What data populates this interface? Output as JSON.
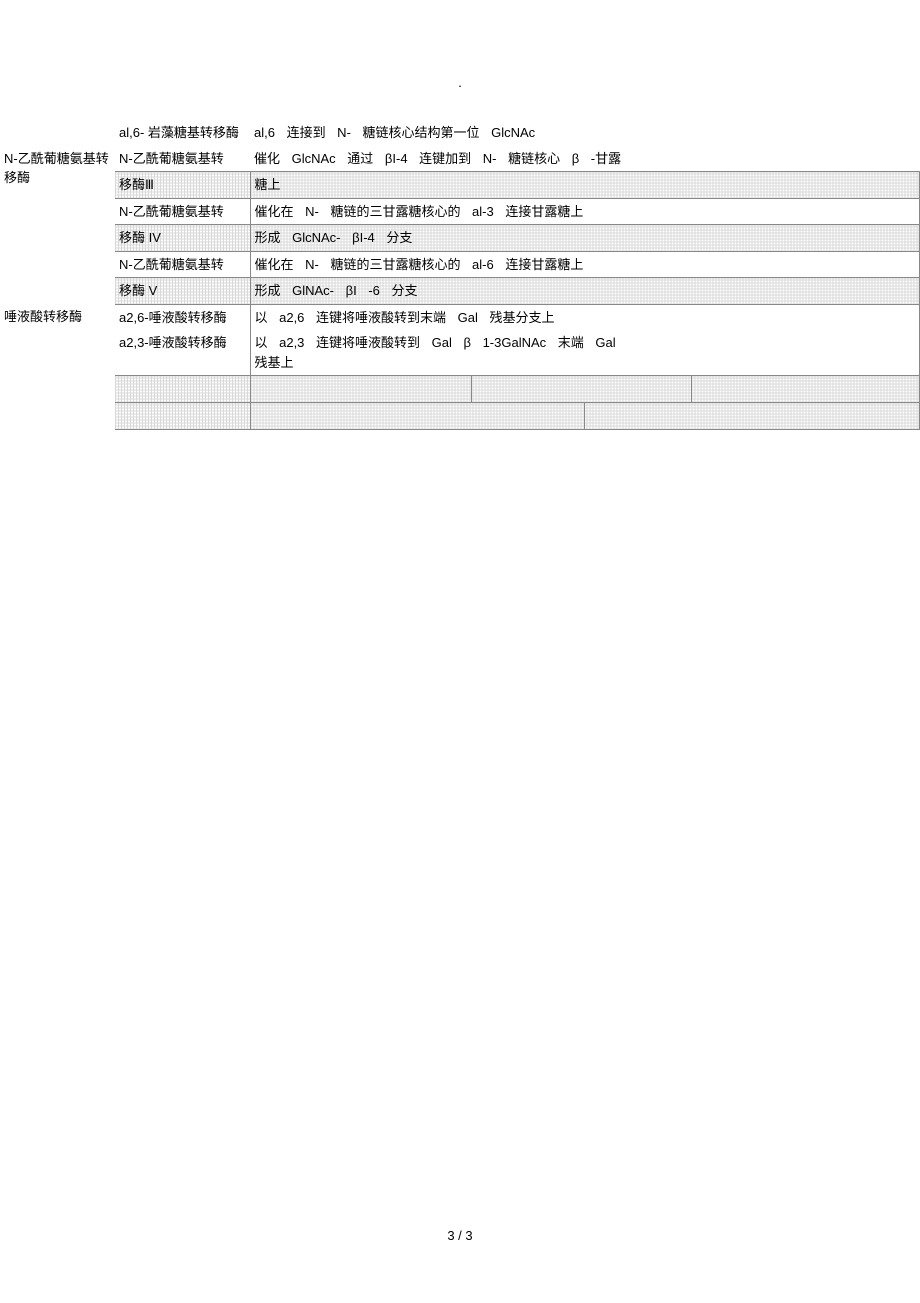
{
  "header": {
    "dot": "."
  },
  "rows": [
    {
      "category": "",
      "enzyme": "al,6- 岩藻糖基转移酶",
      "description": "al,6 连接到 N- 糖链核心结构第一位    GlcNAc"
    },
    {
      "category": "N-乙酰葡糖氨基转移酶",
      "enzyme": "N-乙酰葡糖氨基转移酶Ⅲ",
      "description": "催化 GlcNAc  通过 βI-4 连键加到  N- 糖链核心   β -甘露糖上"
    },
    {
      "category": "",
      "enzyme": "N-乙酰葡糖氨基转移酶 IV",
      "description": "催化在  N- 糖链的三甘露糖核心的     al-3 连接甘露糖上形成 GlcNAc- βI-4 分支"
    },
    {
      "category": "",
      "enzyme": "N-乙酰葡糖氨基转移酶 V",
      "description": "催化在  N- 糖链的三甘露糖核心的     al-6 连接甘露糖上形成 GlNAc- βI -6 分支"
    },
    {
      "category": "唾液酸转移酶",
      "enzyme": "a2,6-唾液酸转移酶",
      "description": "以 a2,6 连键将唾液酸转到末端     Gal 残基分支上"
    },
    {
      "category": "",
      "enzyme": "a2,3-唾液酸转移酶",
      "description": "以 a2,3 连键将唾液酸转到  Gal β 1-3GalNAc  末端 Gal残基上"
    }
  ],
  "footer": {
    "page": "3 / 3"
  }
}
